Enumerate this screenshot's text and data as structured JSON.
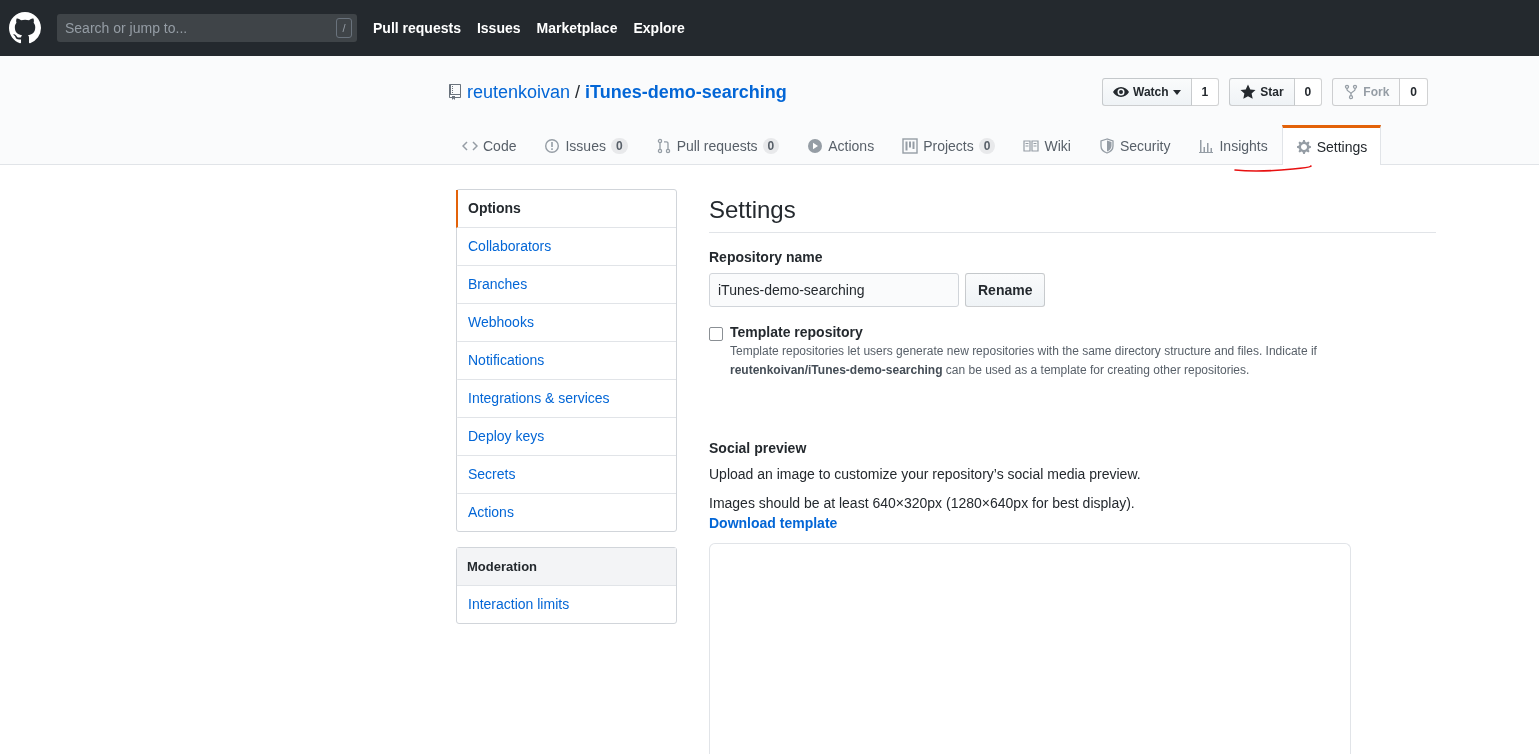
{
  "header": {
    "search": {
      "placeholder": "Search or jump to...",
      "shortcut": "/"
    },
    "nav": [
      "Pull requests",
      "Issues",
      "Marketplace",
      "Explore"
    ]
  },
  "repo": {
    "owner": "reutenkoivan",
    "separator": "/",
    "name": "iTunes-demo-searching",
    "actions": [
      {
        "label": "Watch",
        "count": "1",
        "disabled": false
      },
      {
        "label": "Star",
        "count": "0",
        "disabled": false
      },
      {
        "label": "Fork",
        "count": "0",
        "disabled": true
      }
    ]
  },
  "tabs": [
    {
      "label": "Code",
      "selected": false
    },
    {
      "label": "Issues",
      "count": "0",
      "selected": false
    },
    {
      "label": "Pull requests",
      "count": "0",
      "selected": false
    },
    {
      "label": "Actions",
      "selected": false
    },
    {
      "label": "Projects",
      "count": "0",
      "selected": false
    },
    {
      "label": "Wiki",
      "selected": false
    },
    {
      "label": "Security",
      "selected": false
    },
    {
      "label": "Insights",
      "selected": false
    },
    {
      "label": "Settings",
      "selected": true
    }
  ],
  "sidebar": {
    "groups": [
      {
        "items": [
          {
            "label": "Options",
            "selected": true
          },
          {
            "label": "Collaborators",
            "selected": false
          },
          {
            "label": "Branches",
            "selected": false
          },
          {
            "label": "Webhooks",
            "selected": false
          },
          {
            "label": "Notifications",
            "selected": false
          },
          {
            "label": "Integrations & services",
            "selected": false
          },
          {
            "label": "Deploy keys",
            "selected": false
          },
          {
            "label": "Secrets",
            "selected": false
          },
          {
            "label": "Actions",
            "selected": false
          }
        ]
      },
      {
        "heading": "Moderation",
        "items": [
          {
            "label": "Interaction limits",
            "selected": false
          }
        ]
      }
    ]
  },
  "settings": {
    "title": "Settings",
    "repository_name": {
      "label": "Repository name",
      "value": "iTunes-demo-searching",
      "button": "Rename"
    },
    "template": {
      "label": "Template repository",
      "checked": false,
      "description": "Template repositories let users generate new repositories with the same directory structure and files. Indicate if **reutenkoivan/iTunes-demo-searching** can be used as a template for creating other repositories."
    },
    "social_preview": {
      "heading": "Social preview",
      "text": "Upload an image to customize your repository’s social media preview.",
      "hint": "Images should be at least 640×320px (1280×640px for best display).",
      "link": "Download template"
    }
  }
}
